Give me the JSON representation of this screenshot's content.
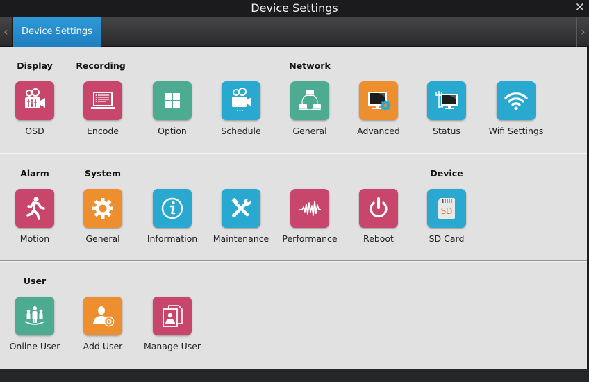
{
  "window": {
    "title": "Device Settings",
    "close_icon": "close-icon"
  },
  "tabbar": {
    "left_arrow": "‹",
    "right_arrow": "›",
    "tabs": [
      {
        "label": "Device Settings",
        "active": true
      }
    ]
  },
  "colors": {
    "pink": "#c8466b",
    "green": "#4cab90",
    "blue": "#2aa9d0",
    "orange": "#ee8f2f",
    "tab_active": "#2e9ad8",
    "panel_bg": "#e1e1e1"
  },
  "sections": {
    "display": "Display",
    "recording": "Recording",
    "network": "Network",
    "alarm": "Alarm",
    "system": "System",
    "device": "Device",
    "user": "User"
  },
  "items": {
    "osd": {
      "label": "OSD",
      "icon": "camera-sliders-icon",
      "color": "pink"
    },
    "encode": {
      "label": "Encode",
      "icon": "laptop-settings-icon",
      "color": "pink"
    },
    "option": {
      "label": "Option",
      "icon": "grid-icon",
      "color": "green"
    },
    "schedule": {
      "label": "Schedule",
      "icon": "video-camera-icon",
      "color": "blue"
    },
    "network_general": {
      "label": "General",
      "icon": "network-topology-icon",
      "color": "green"
    },
    "advanced": {
      "label": "Advanced",
      "icon": "monitor-gear-icon",
      "color": "orange"
    },
    "status": {
      "label": "Status",
      "icon": "monitor-antenna-icon",
      "color": "blue"
    },
    "wifi": {
      "label": "Wifi Settings",
      "icon": "wifi-icon",
      "color": "blue"
    },
    "motion": {
      "label": "Motion",
      "icon": "running-man-icon",
      "color": "pink"
    },
    "system_general": {
      "label": "General",
      "icon": "gear-icon",
      "color": "orange"
    },
    "information": {
      "label": "Information",
      "icon": "info-icon",
      "color": "blue"
    },
    "maintenance": {
      "label": "Maintenance",
      "icon": "tools-icon",
      "color": "blue"
    },
    "performance": {
      "label": "Performance",
      "icon": "waveform-icon",
      "color": "pink"
    },
    "reboot": {
      "label": "Reboot",
      "icon": "power-icon",
      "color": "pink"
    },
    "sdcard": {
      "label": "SD Card",
      "icon": "sd-card-icon",
      "color": "blue",
      "card_text": "SD"
    },
    "online_user": {
      "label": "Online User",
      "icon": "users-group-icon",
      "color": "green"
    },
    "add_user": {
      "label": "Add User",
      "icon": "add-user-icon",
      "color": "orange"
    },
    "manage_user": {
      "label": "Manage User",
      "icon": "user-cards-icon",
      "color": "pink"
    }
  }
}
